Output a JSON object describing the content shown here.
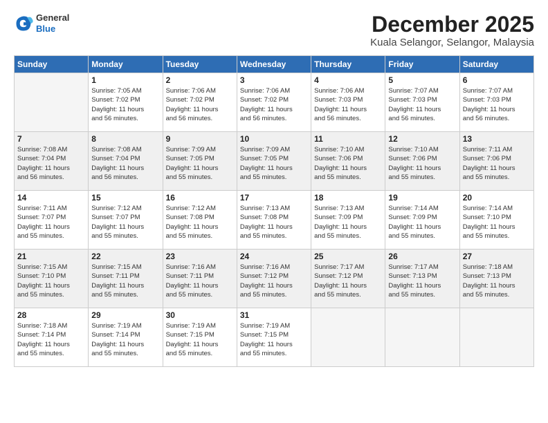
{
  "logo": {
    "general": "General",
    "blue": "Blue"
  },
  "title": "December 2025",
  "location": "Kuala Selangor, Selangor, Malaysia",
  "weekdays": [
    "Sunday",
    "Monday",
    "Tuesday",
    "Wednesday",
    "Thursday",
    "Friday",
    "Saturday"
  ],
  "weeks": [
    {
      "shaded": false,
      "days": [
        {
          "num": "",
          "detail": ""
        },
        {
          "num": "1",
          "detail": "Sunrise: 7:05 AM\nSunset: 7:02 PM\nDaylight: 11 hours\nand 56 minutes."
        },
        {
          "num": "2",
          "detail": "Sunrise: 7:06 AM\nSunset: 7:02 PM\nDaylight: 11 hours\nand 56 minutes."
        },
        {
          "num": "3",
          "detail": "Sunrise: 7:06 AM\nSunset: 7:02 PM\nDaylight: 11 hours\nand 56 minutes."
        },
        {
          "num": "4",
          "detail": "Sunrise: 7:06 AM\nSunset: 7:03 PM\nDaylight: 11 hours\nand 56 minutes."
        },
        {
          "num": "5",
          "detail": "Sunrise: 7:07 AM\nSunset: 7:03 PM\nDaylight: 11 hours\nand 56 minutes."
        },
        {
          "num": "6",
          "detail": "Sunrise: 7:07 AM\nSunset: 7:03 PM\nDaylight: 11 hours\nand 56 minutes."
        }
      ]
    },
    {
      "shaded": true,
      "days": [
        {
          "num": "7",
          "detail": "Sunrise: 7:08 AM\nSunset: 7:04 PM\nDaylight: 11 hours\nand 56 minutes."
        },
        {
          "num": "8",
          "detail": "Sunrise: 7:08 AM\nSunset: 7:04 PM\nDaylight: 11 hours\nand 56 minutes."
        },
        {
          "num": "9",
          "detail": "Sunrise: 7:09 AM\nSunset: 7:05 PM\nDaylight: 11 hours\nand 55 minutes."
        },
        {
          "num": "10",
          "detail": "Sunrise: 7:09 AM\nSunset: 7:05 PM\nDaylight: 11 hours\nand 55 minutes."
        },
        {
          "num": "11",
          "detail": "Sunrise: 7:10 AM\nSunset: 7:06 PM\nDaylight: 11 hours\nand 55 minutes."
        },
        {
          "num": "12",
          "detail": "Sunrise: 7:10 AM\nSunset: 7:06 PM\nDaylight: 11 hours\nand 55 minutes."
        },
        {
          "num": "13",
          "detail": "Sunrise: 7:11 AM\nSunset: 7:06 PM\nDaylight: 11 hours\nand 55 minutes."
        }
      ]
    },
    {
      "shaded": false,
      "days": [
        {
          "num": "14",
          "detail": "Sunrise: 7:11 AM\nSunset: 7:07 PM\nDaylight: 11 hours\nand 55 minutes."
        },
        {
          "num": "15",
          "detail": "Sunrise: 7:12 AM\nSunset: 7:07 PM\nDaylight: 11 hours\nand 55 minutes."
        },
        {
          "num": "16",
          "detail": "Sunrise: 7:12 AM\nSunset: 7:08 PM\nDaylight: 11 hours\nand 55 minutes."
        },
        {
          "num": "17",
          "detail": "Sunrise: 7:13 AM\nSunset: 7:08 PM\nDaylight: 11 hours\nand 55 minutes."
        },
        {
          "num": "18",
          "detail": "Sunrise: 7:13 AM\nSunset: 7:09 PM\nDaylight: 11 hours\nand 55 minutes."
        },
        {
          "num": "19",
          "detail": "Sunrise: 7:14 AM\nSunset: 7:09 PM\nDaylight: 11 hours\nand 55 minutes."
        },
        {
          "num": "20",
          "detail": "Sunrise: 7:14 AM\nSunset: 7:10 PM\nDaylight: 11 hours\nand 55 minutes."
        }
      ]
    },
    {
      "shaded": true,
      "days": [
        {
          "num": "21",
          "detail": "Sunrise: 7:15 AM\nSunset: 7:10 PM\nDaylight: 11 hours\nand 55 minutes."
        },
        {
          "num": "22",
          "detail": "Sunrise: 7:15 AM\nSunset: 7:11 PM\nDaylight: 11 hours\nand 55 minutes."
        },
        {
          "num": "23",
          "detail": "Sunrise: 7:16 AM\nSunset: 7:11 PM\nDaylight: 11 hours\nand 55 minutes."
        },
        {
          "num": "24",
          "detail": "Sunrise: 7:16 AM\nSunset: 7:12 PM\nDaylight: 11 hours\nand 55 minutes."
        },
        {
          "num": "25",
          "detail": "Sunrise: 7:17 AM\nSunset: 7:12 PM\nDaylight: 11 hours\nand 55 minutes."
        },
        {
          "num": "26",
          "detail": "Sunrise: 7:17 AM\nSunset: 7:13 PM\nDaylight: 11 hours\nand 55 minutes."
        },
        {
          "num": "27",
          "detail": "Sunrise: 7:18 AM\nSunset: 7:13 PM\nDaylight: 11 hours\nand 55 minutes."
        }
      ]
    },
    {
      "shaded": false,
      "days": [
        {
          "num": "28",
          "detail": "Sunrise: 7:18 AM\nSunset: 7:14 PM\nDaylight: 11 hours\nand 55 minutes."
        },
        {
          "num": "29",
          "detail": "Sunrise: 7:19 AM\nSunset: 7:14 PM\nDaylight: 11 hours\nand 55 minutes."
        },
        {
          "num": "30",
          "detail": "Sunrise: 7:19 AM\nSunset: 7:15 PM\nDaylight: 11 hours\nand 55 minutes."
        },
        {
          "num": "31",
          "detail": "Sunrise: 7:19 AM\nSunset: 7:15 PM\nDaylight: 11 hours\nand 55 minutes."
        },
        {
          "num": "",
          "detail": ""
        },
        {
          "num": "",
          "detail": ""
        },
        {
          "num": "",
          "detail": ""
        }
      ]
    }
  ]
}
